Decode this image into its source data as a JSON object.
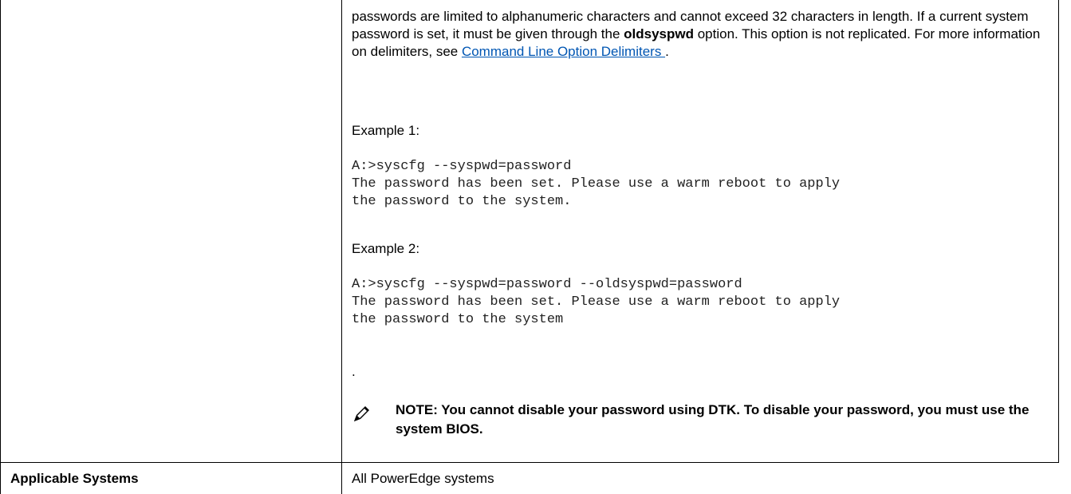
{
  "description": {
    "paragraph_pre": "passwords are limited to alphanumeric characters and cannot exceed 32 characters in length. If a current system password is set, it must be given through the ",
    "paragraph_bold": "oldsyspwd",
    "paragraph_post": " option. This option is not replicated. For more information on delimiters, see ",
    "link_text": "Command Line Option Delimiters ",
    "paragraph_end": ".",
    "example1_label": "Example 1:",
    "example1_code": "A:>syscfg --syspwd=password\nThe password has been set. Please use a warm reboot to apply\nthe password to the system.",
    "example2_label": "Example 2:",
    "example2_code": "A:>syscfg --syspwd=password --oldsyspwd=password\nThe password has been set. Please use a warm reboot to apply\nthe password to the system",
    "trailing_dot": "."
  },
  "note": {
    "icon": "pencil-note-icon",
    "text": "NOTE: You cannot disable your password using DTK. To disable your password, you must use the system BIOS."
  },
  "applicable_systems": {
    "label": "Applicable Systems",
    "value": "All PowerEdge systems"
  }
}
